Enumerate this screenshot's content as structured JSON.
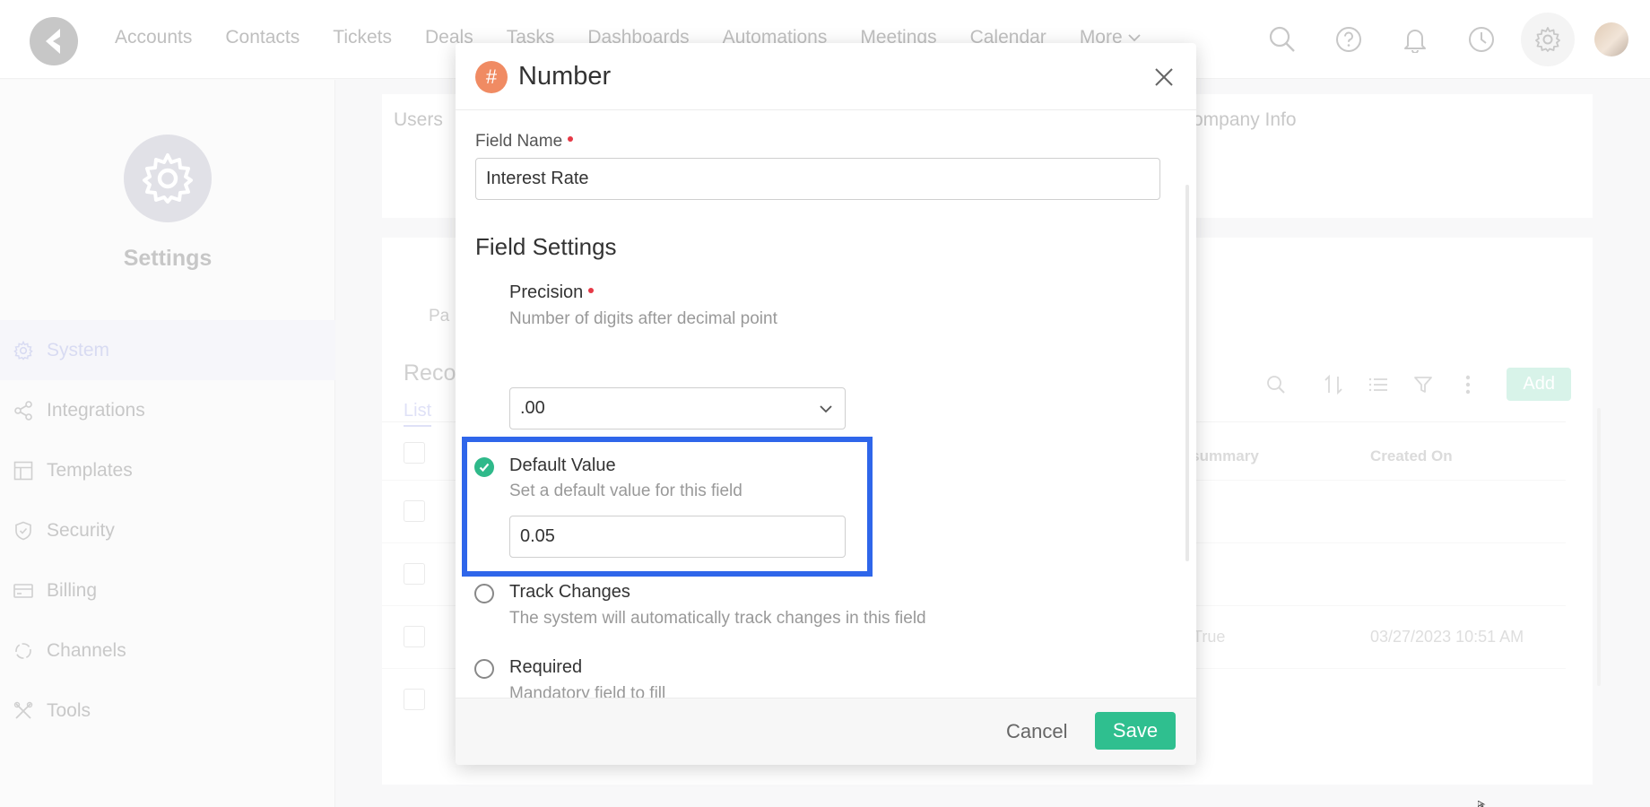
{
  "nav": {
    "items": [
      "Accounts",
      "Contacts",
      "Tickets",
      "Deals",
      "Tasks",
      "Dashboards",
      "Automations",
      "Meetings",
      "Calendar"
    ],
    "more_label": "More",
    "icons": [
      "search-icon",
      "help-icon",
      "bell-icon",
      "clock-icon",
      "gear-icon"
    ]
  },
  "sidebar": {
    "title": "Settings",
    "items": [
      {
        "label": "System",
        "icon": "gear-icon"
      },
      {
        "label": "Integrations",
        "icon": "share-icon"
      },
      {
        "label": "Templates",
        "icon": "layout-icon"
      },
      {
        "label": "Security",
        "icon": "shield-icon"
      },
      {
        "label": "Billing",
        "icon": "card-icon"
      },
      {
        "label": "Channels",
        "icon": "channels-icon"
      },
      {
        "label": "Tools",
        "icon": "tools-icon"
      }
    ]
  },
  "background": {
    "tabs": [
      "Users",
      "ompany Info"
    ],
    "pa_label": "Pa",
    "records_title": "Reco",
    "list_tab": "List",
    "add_label": "Add",
    "columns": [
      "s summary",
      "Created On"
    ],
    "row_cells": [
      {
        "summary": "",
        "created": ""
      },
      {
        "summary": "",
        "created": ""
      },
      {
        "summary": "True",
        "created": "03/27/2023 10:51 AM"
      },
      {
        "summary": "",
        "created": ""
      }
    ]
  },
  "dialog": {
    "title": "Number",
    "hash_glyph": "#",
    "field_name_label": "Field Name",
    "field_name_value": "Interest Rate",
    "section_title": "Field Settings",
    "precision": {
      "title": "Precision",
      "desc": "Number of digits after decimal point",
      "selected": ".00"
    },
    "default_value": {
      "title": "Default Value",
      "desc": "Set a default value for this field",
      "value": "0.05",
      "checked": true
    },
    "track_changes": {
      "title": "Track Changes",
      "desc": "The system will automatically track changes in this field",
      "checked": false
    },
    "required": {
      "title": "Required",
      "desc": "Mandatory field to fill",
      "checked": false
    },
    "cancel_label": "Cancel",
    "save_label": "Save"
  },
  "colors": {
    "accent": "#2fbf8f",
    "highlight": "#2f66ea",
    "hash_badge": "#f08b63",
    "required_dot": "#e63946"
  }
}
